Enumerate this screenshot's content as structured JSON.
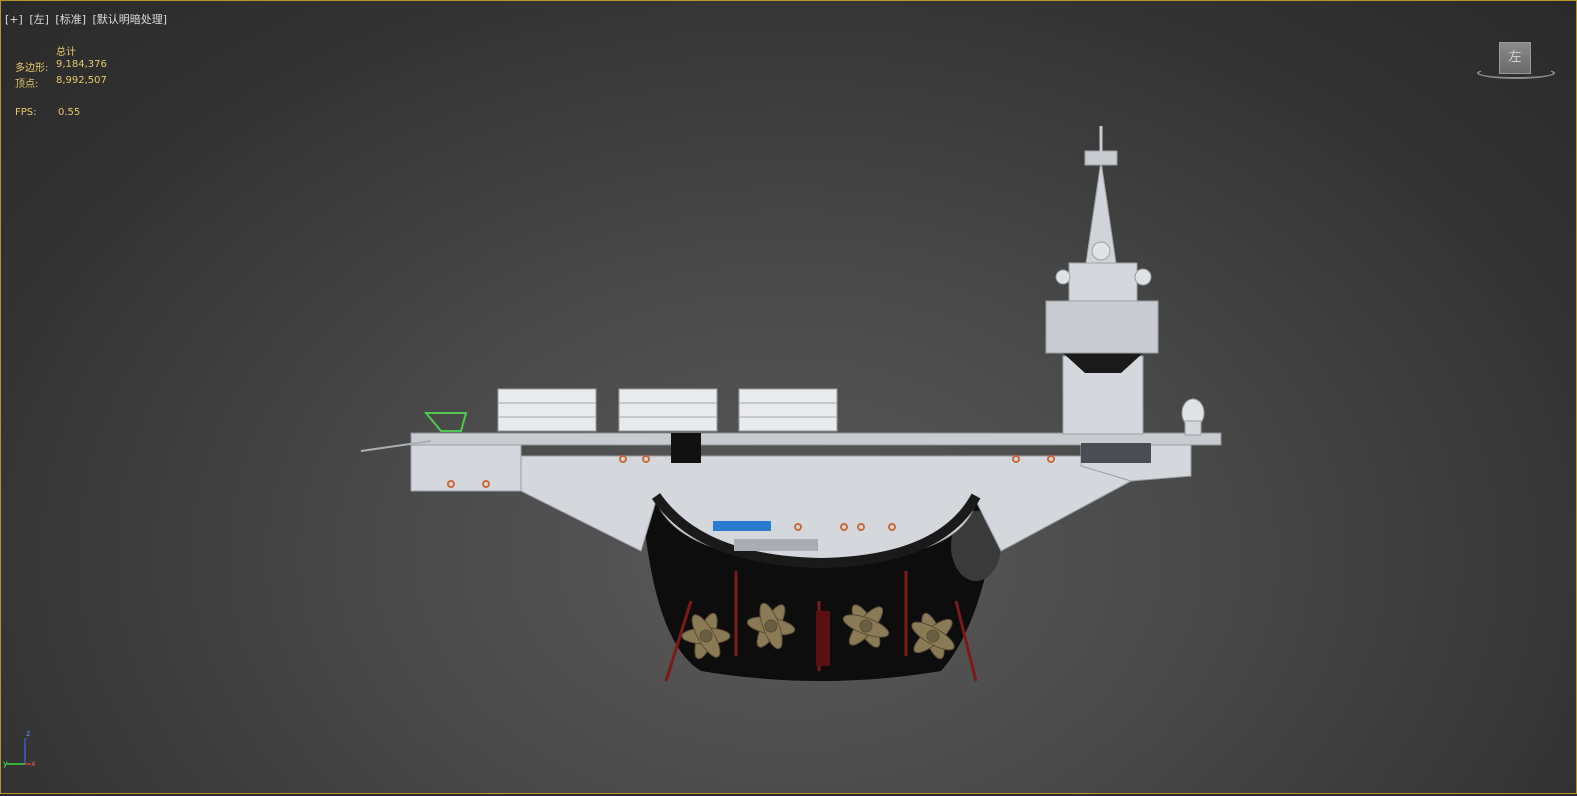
{
  "viewport": {
    "labels": [
      "[+]",
      "[左]",
      "[标准]",
      "[默认明暗处理]"
    ]
  },
  "stats": {
    "header": "总计",
    "polygons_label": "多边形:",
    "polygons_value": "9,184,376",
    "vertices_label": "顶点:",
    "vertices_value": "8,992,507",
    "fps_label": "FPS:",
    "fps_value": "0.55"
  },
  "viewcube": {
    "face_label": "左"
  },
  "axis_gizmo": {
    "z": "z",
    "y": "y",
    "x": "x"
  },
  "colors": {
    "border": "#b8962a",
    "stats_text": "#e6c86e",
    "hull_gray": "#d4d8dc",
    "hull_dark": "#0d0d0d",
    "propeller": "#8a7a55"
  }
}
